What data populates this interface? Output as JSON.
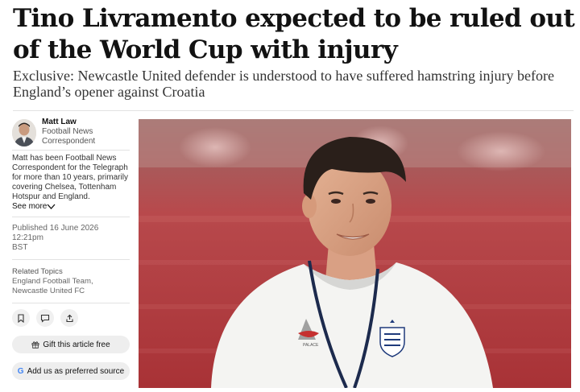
{
  "article": {
    "headline": "Tino Livramento expected to be ruled out of the World Cup with injury",
    "standfirst": "Exclusive: Newcastle United defender is understood to have suffered hamstring injury before England’s opener against Croatia"
  },
  "author": {
    "name": "Matt Law",
    "role_line1": "Football News",
    "role_line2": "Correspondent",
    "bio": "Matt has been Football News Correspondent for the Telegraph for more than 10 years, primarily covering Chelsea, Tottenham Hotspur and England.",
    "see_more": "See more"
  },
  "published": {
    "line1": "Published 16 June 2026 12:21pm",
    "line2": "BST"
  },
  "topics": {
    "title": "Related Topics",
    "list": "England Football Team, Newcastle United FC"
  },
  "actions": {
    "gift_label": "Gift this article free",
    "preferred_label": "Add us as preferred source",
    "icons": [
      "bookmark-icon",
      "comment-icon",
      "share-icon"
    ]
  },
  "photo": {
    "subject": "player in white England training shirt with lanyard"
  },
  "colors": {
    "text": "#121212",
    "stand_bg_red": "#b83a3e",
    "pill_bg": "#eeeeee"
  }
}
